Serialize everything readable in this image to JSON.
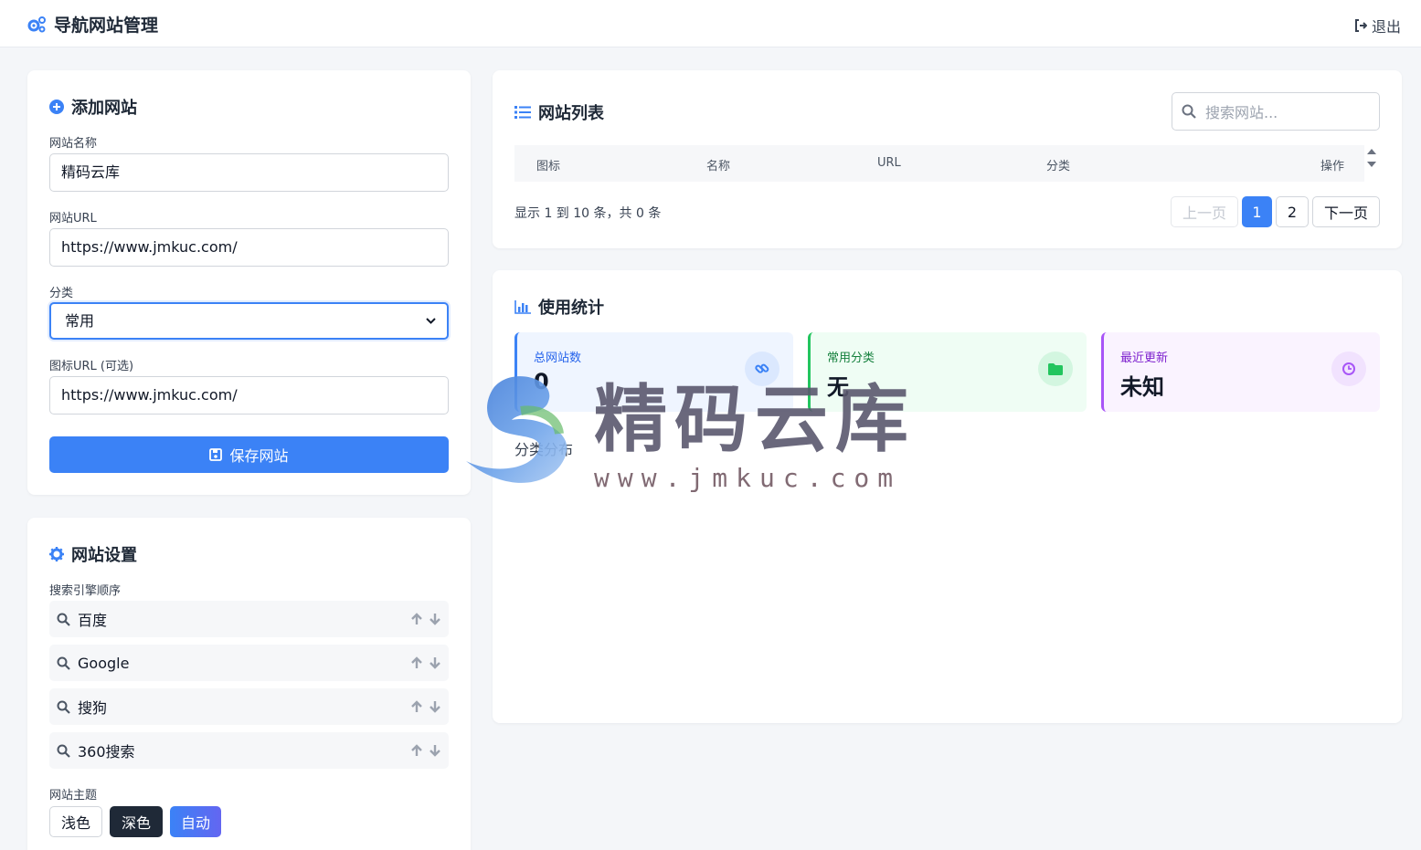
{
  "header": {
    "title": "导航网站管理",
    "logout_label": "退出"
  },
  "add_site": {
    "title": "添加网站",
    "name_label": "网站名称",
    "name_value": "精码云库",
    "url_label": "网站URL",
    "url_value": "https://www.jmkuc.com/",
    "category_label": "分类",
    "category_value": "常用",
    "icon_label": "图标URL (可选)",
    "icon_value": "https://www.jmkuc.com/",
    "save_label": "保存网站"
  },
  "settings": {
    "title": "网站设置",
    "engine_order_label": "搜索引擎顺序",
    "engines": [
      {
        "name": "百度"
      },
      {
        "name": "Google"
      },
      {
        "name": "搜狗"
      },
      {
        "name": "360搜索"
      }
    ],
    "theme_label": "网站主题",
    "themes": [
      "浅色",
      "深色",
      "自动"
    ]
  },
  "site_list": {
    "title": "网站列表",
    "search_placeholder": "搜索网站...",
    "columns": [
      "图标",
      "名称",
      "URL",
      "分类",
      "操作"
    ],
    "page_info": "显示 1 到 10 条，共 0 条",
    "prev_label": "上一页",
    "pages": [
      "1",
      "2"
    ],
    "next_label": "下一页"
  },
  "stats": {
    "title": "使用统计",
    "cards": [
      {
        "label": "总网站数",
        "value": "0",
        "color": "#3b82f6"
      },
      {
        "label": "常用分类",
        "value": "无",
        "color": "#22c55e"
      },
      {
        "label": "最近更新",
        "value": "未知",
        "color": "#a855f7"
      }
    ],
    "chart_title": "分类分布"
  },
  "watermark": {
    "text": "精码云库",
    "url": "www.jmkuc.com"
  },
  "colors": {
    "accent": "#3b82f6",
    "dark": "#1f2937"
  }
}
